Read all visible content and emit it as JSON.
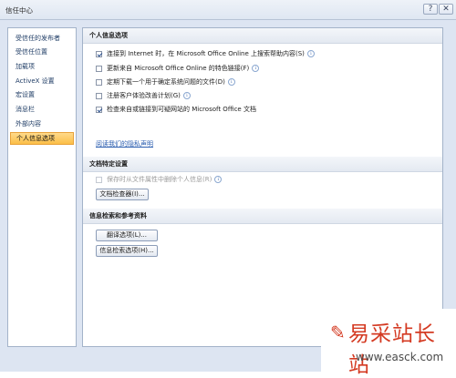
{
  "window": {
    "title": "信任中心",
    "help_glyph": "?",
    "close_glyph": "✕"
  },
  "sidebar": {
    "items": [
      {
        "label": "受信任的发布者"
      },
      {
        "label": "受信任位置"
      },
      {
        "label": "加载项"
      },
      {
        "label": "ActiveX 设置"
      },
      {
        "label": "宏设置"
      },
      {
        "label": "消息栏"
      },
      {
        "label": "外部内容"
      },
      {
        "label": "个人信息选项",
        "active": true
      }
    ]
  },
  "sections": {
    "personal": {
      "title": "个人信息选项",
      "options": [
        {
          "label": "连接到 Internet 时，在 Microsoft Office Online 上搜索帮助内容(S)",
          "checked": true
        },
        {
          "label": "更新来自 Microsoft Office Online 的特色链接(F)",
          "checked": false
        },
        {
          "label": "定期下载一个用于确定系统问题的文件(D)",
          "checked": false
        },
        {
          "label": "注册客户体验改善计划(G)",
          "checked": false
        },
        {
          "label": "检查来自或链接到可疑网站的 Microsoft Office 文档",
          "checked": true
        }
      ],
      "privacy_link": "阅读我们的隐私声明"
    },
    "doc": {
      "title": "文档特定设置",
      "option": {
        "label": "保存时从文件属性中删除个人信息(R)",
        "checked": false,
        "disabled": true
      },
      "inspector_button": "文档检查器(I)..."
    },
    "research": {
      "title": "信息检索和参考资料",
      "translate_button": "翻译选项(L)...",
      "research_button": "信息检索选项(H)..."
    }
  },
  "watermark": {
    "text": "易采站长站",
    "url": "www.easck.com"
  },
  "colors": {
    "accent_active": "#fbbf48",
    "link": "#2d5fb0",
    "watermark": "#d43a22"
  },
  "icons": {
    "info": "info-icon",
    "check": "checkmark"
  }
}
